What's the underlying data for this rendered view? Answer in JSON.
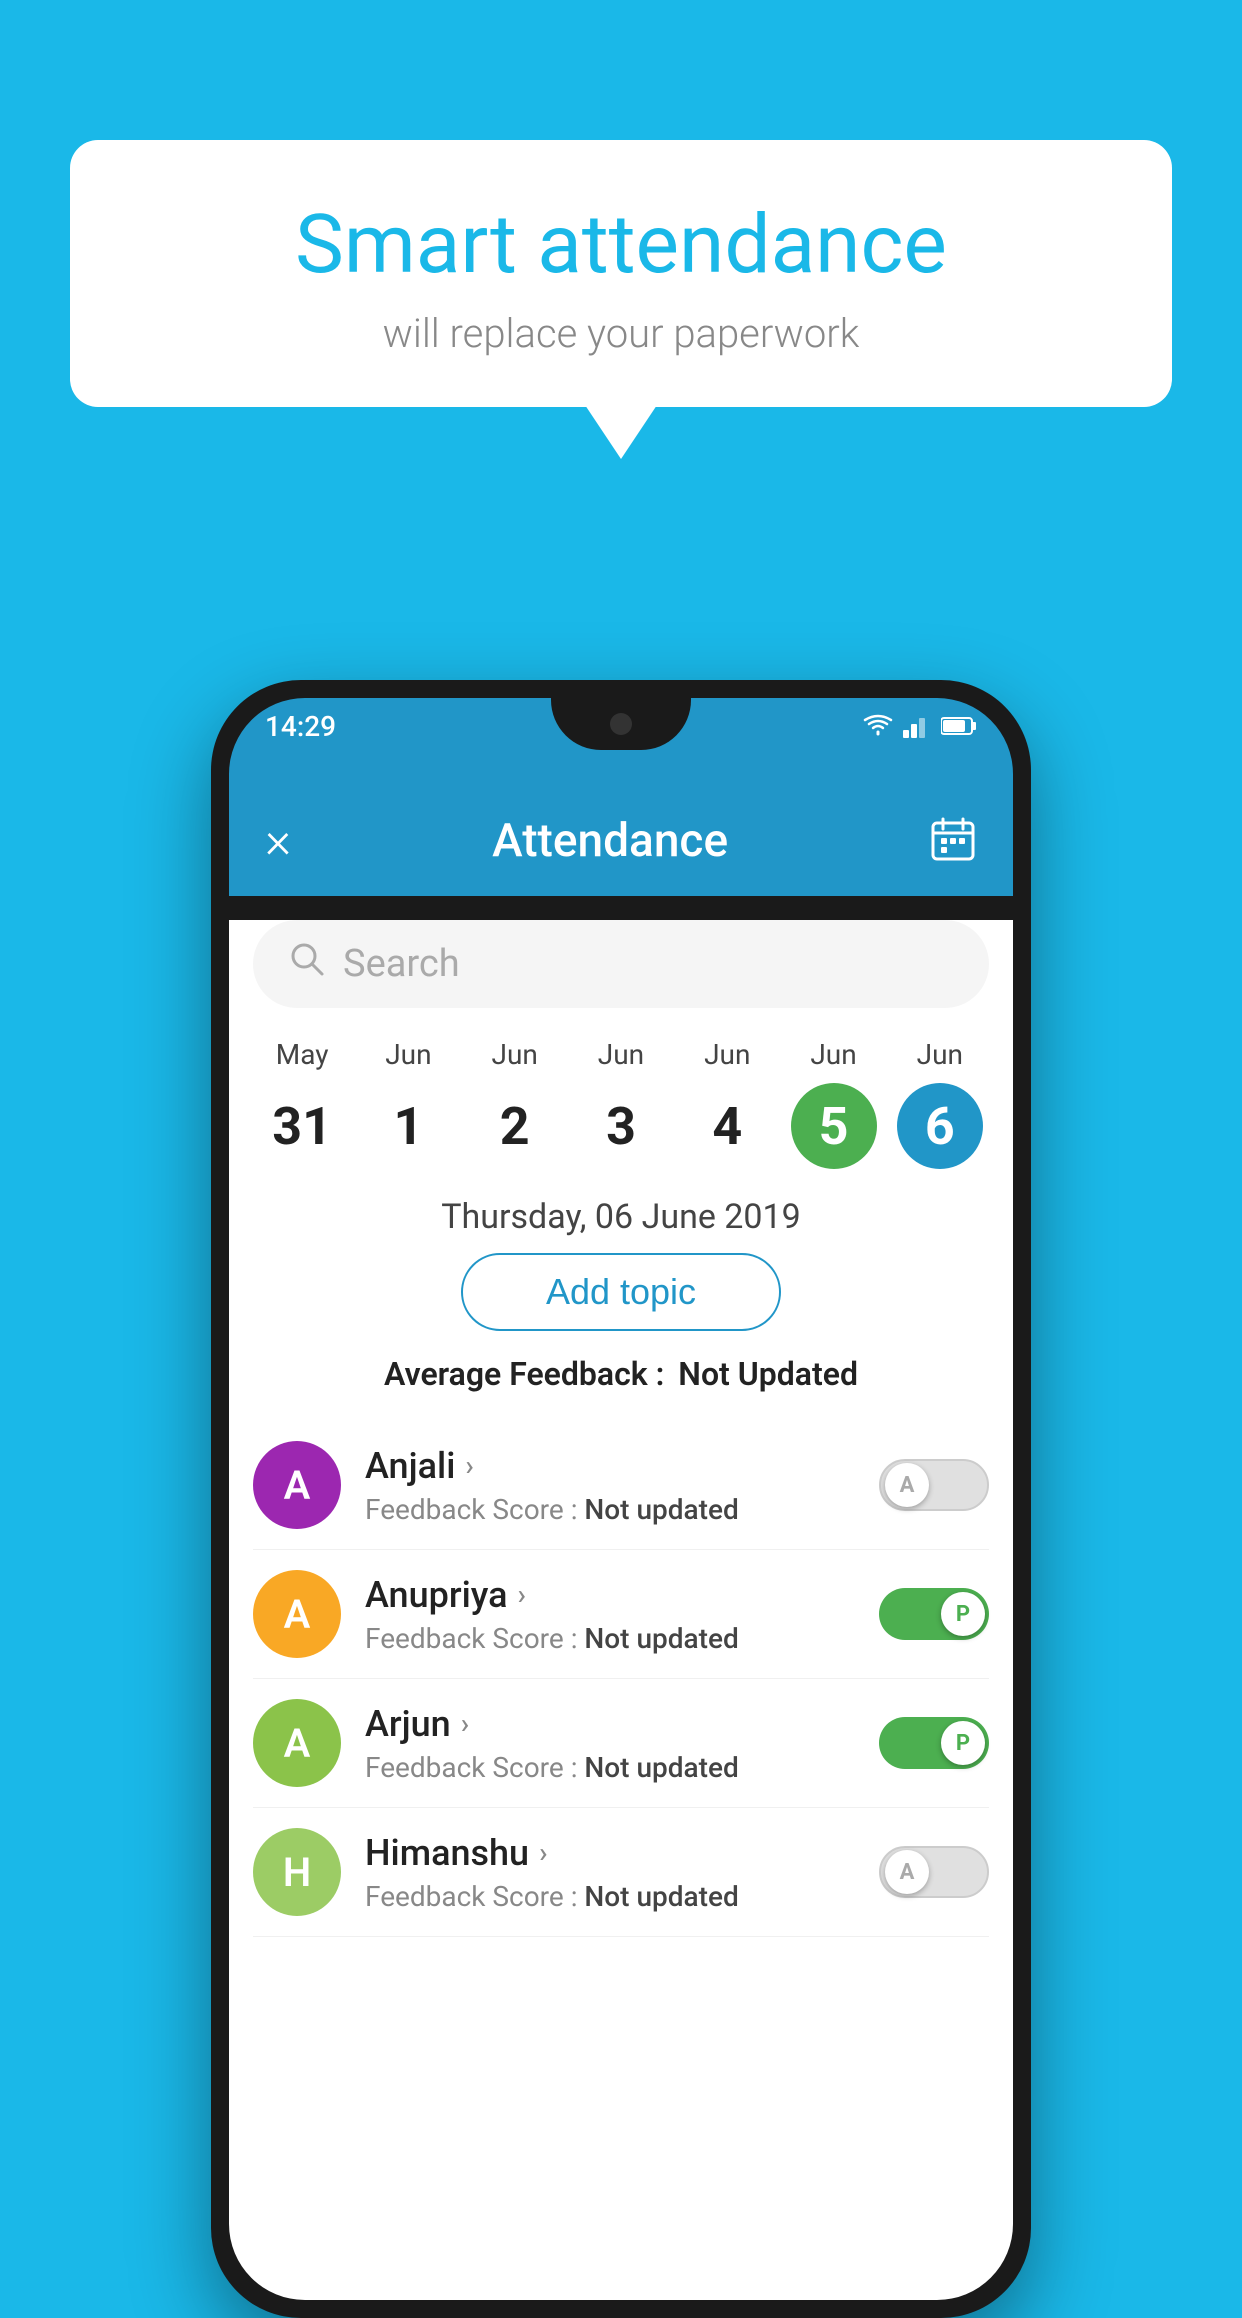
{
  "background_color": "#1ab8e8",
  "speech_bubble": {
    "title": "Smart attendance",
    "subtitle": "will replace your paperwork"
  },
  "status_bar": {
    "time": "14:29",
    "icons": [
      "wifi",
      "signal",
      "battery"
    ]
  },
  "app_bar": {
    "title": "Attendance",
    "close_icon": "×",
    "calendar_icon": "📅"
  },
  "search": {
    "placeholder": "Search"
  },
  "calendar": {
    "days": [
      {
        "month": "May",
        "num": "31",
        "highlight": "none"
      },
      {
        "month": "Jun",
        "num": "1",
        "highlight": "none"
      },
      {
        "month": "Jun",
        "num": "2",
        "highlight": "none"
      },
      {
        "month": "Jun",
        "num": "3",
        "highlight": "none"
      },
      {
        "month": "Jun",
        "num": "4",
        "highlight": "none"
      },
      {
        "month": "Jun",
        "num": "5",
        "highlight": "today-green"
      },
      {
        "month": "Jun",
        "num": "6",
        "highlight": "selected-blue"
      }
    ]
  },
  "selected_date": "Thursday, 06 June 2019",
  "add_topic_label": "Add topic",
  "average_feedback_label": "Average Feedback :",
  "average_feedback_value": "Not Updated",
  "students": [
    {
      "name": "Anjali",
      "avatar_letter": "A",
      "avatar_color": "purple",
      "feedback_label": "Feedback Score :",
      "feedback_value": "Not updated",
      "toggle": "off",
      "toggle_letter": "A"
    },
    {
      "name": "Anupriya",
      "avatar_letter": "A",
      "avatar_color": "orange",
      "feedback_label": "Feedback Score :",
      "feedback_value": "Not updated",
      "toggle": "on",
      "toggle_letter": "P"
    },
    {
      "name": "Arjun",
      "avatar_letter": "A",
      "avatar_color": "green",
      "feedback_label": "Feedback Score :",
      "feedback_value": "Not updated",
      "toggle": "on",
      "toggle_letter": "P"
    },
    {
      "name": "Himanshu",
      "avatar_letter": "H",
      "avatar_color": "light-green",
      "feedback_label": "Feedback Score :",
      "feedback_value": "Not updated",
      "toggle": "off",
      "toggle_letter": "A"
    }
  ]
}
